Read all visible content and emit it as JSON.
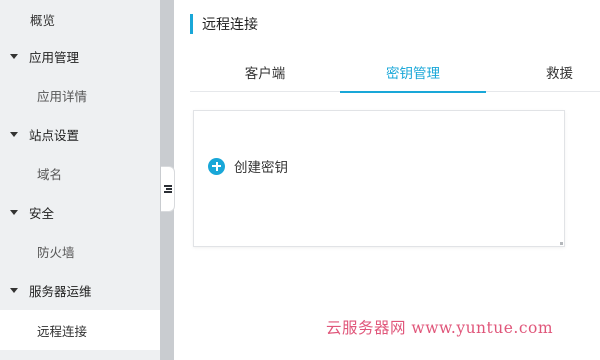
{
  "sidebar": {
    "overview": "概览",
    "groups": [
      {
        "label": "应用管理",
        "items": [
          "应用详情"
        ]
      },
      {
        "label": "站点设置",
        "items": [
          "域名"
        ]
      },
      {
        "label": "安全",
        "items": [
          "防火墙"
        ]
      },
      {
        "label": "服务器运维",
        "items": [
          "远程连接"
        ]
      }
    ],
    "active_item": "远程连接"
  },
  "page": {
    "title": "远程连接"
  },
  "tabs": [
    "客户端",
    "密钥管理",
    "救援"
  ],
  "active_tab": "密钥管理",
  "card": {
    "create_key_label": "创建密钥"
  },
  "watermark": "云服务器网 www.yuntue.com",
  "colors": {
    "accent": "#19a7d8",
    "sidebar_bg": "#eef0f2",
    "watermark": "#e0567a"
  },
  "icons": {
    "create": "plus-circle-icon",
    "collapse": "sidebar-toggle-icon",
    "group_expand": "caret-down-icon"
  }
}
